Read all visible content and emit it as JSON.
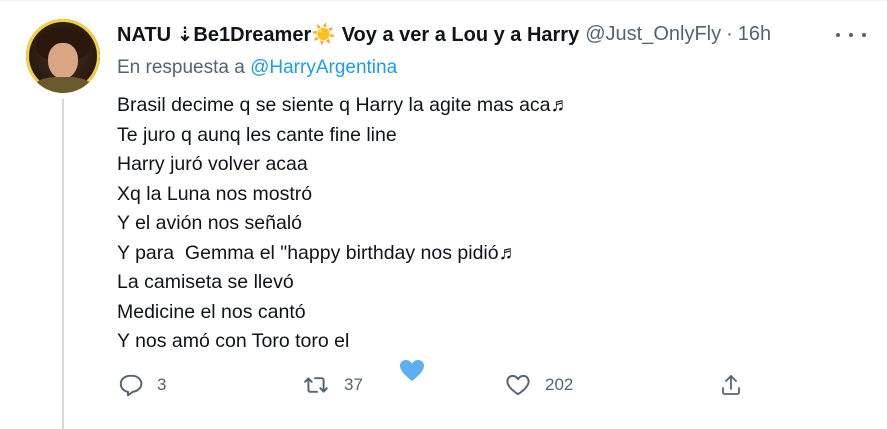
{
  "tweet": {
    "display_name": "NATU ⇣Be1Dreamer☀️ Voy a ver a Lou y a Harry",
    "handle": "@Just_OnlyFly",
    "separator": "·",
    "time": "16h",
    "reply_prefix": "En respuesta a",
    "reply_mention": "@HarryArgentina",
    "lines": [
      "Brasil decime q se siente q Harry la agite mas aca♬",
      "Te juro q aunq les cante fine line",
      "Harry juró volver acaa",
      "Xq la Luna nos mostró",
      "Y el avión nos señaló",
      "Y para  Gemma el \"happy birthday nos pidió♬",
      "La camiseta se llevó",
      "Medicine el nos cantó",
      "Y nos amó con Toro toro el"
    ],
    "heart_emoji": "blue-heart-emoji",
    "heart_color": "#5eaef0",
    "counts": {
      "replies": "3",
      "retweets": "37",
      "likes": "202"
    }
  },
  "icons": {
    "reply": "reply-icon",
    "retweet": "retweet-icon",
    "like": "heart-icon",
    "share": "share-icon",
    "more": "more-icon"
  },
  "colors": {
    "text": "#0f1419",
    "secondary": "#536471",
    "link": "#1d9bf0"
  }
}
